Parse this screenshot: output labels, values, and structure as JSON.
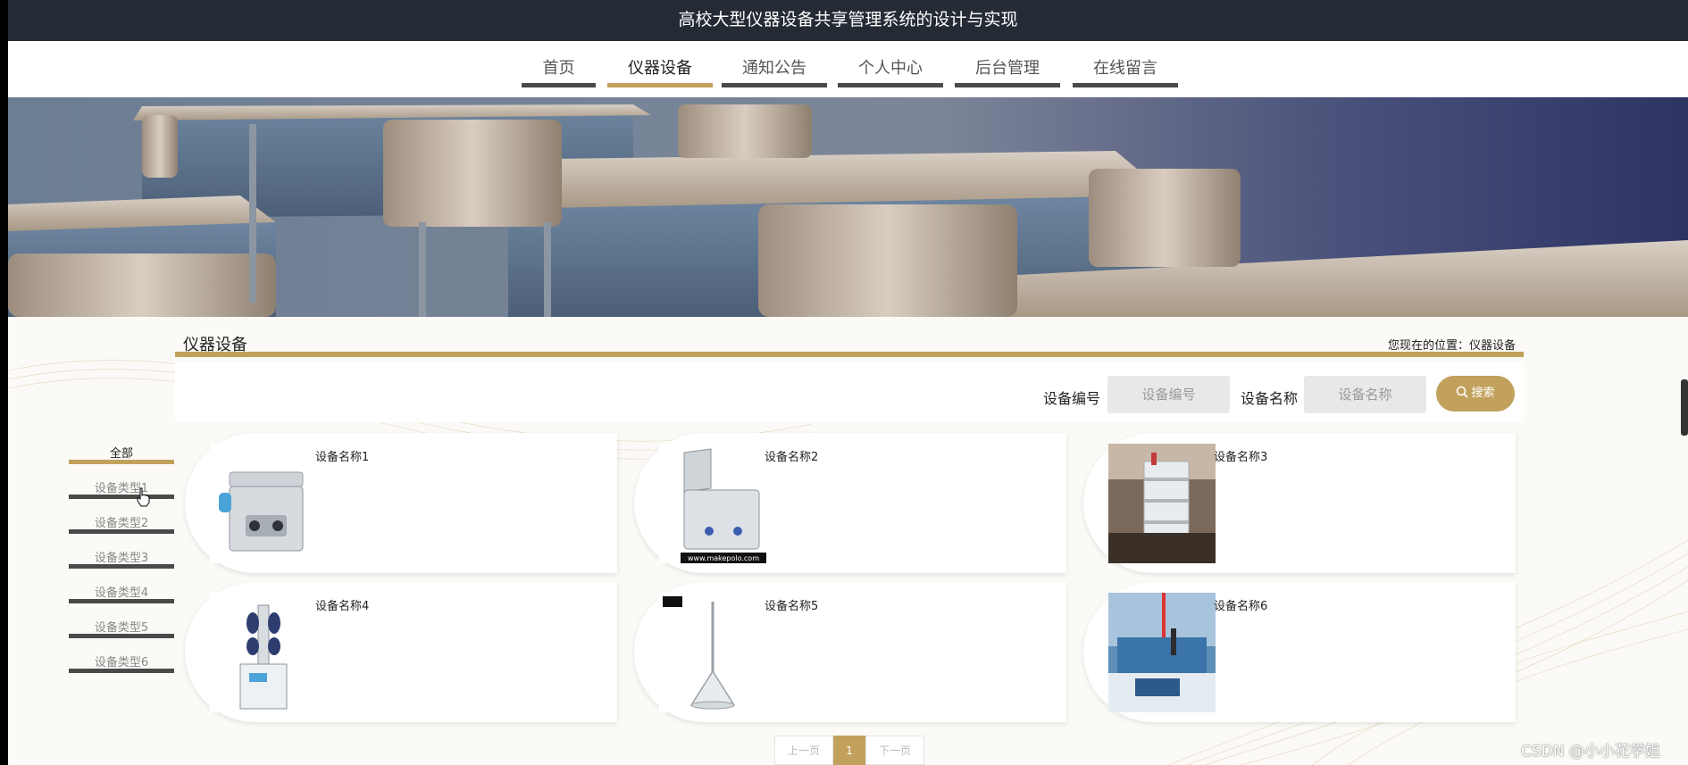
{
  "header": {
    "title": "高校大型仪器设备共享管理系统的设计与实现"
  },
  "nav": {
    "items": [
      {
        "label": "首页",
        "active": false
      },
      {
        "label": "仪器设备",
        "active": true
      },
      {
        "label": "通知公告",
        "active": false
      },
      {
        "label": "个人中心",
        "active": false
      },
      {
        "label": "后台管理",
        "active": false
      },
      {
        "label": "在线留言",
        "active": false
      }
    ]
  },
  "section": {
    "title": "仪器设备",
    "breadcrumb": "您现在的位置：仪器设备"
  },
  "search": {
    "code_label": "设备编号",
    "code_placeholder": "设备编号",
    "name_label": "设备名称",
    "name_placeholder": "设备名称",
    "button_label": "搜索",
    "button_icon": "search-icon"
  },
  "sidebar": {
    "items": [
      {
        "label": "全部",
        "active": true
      },
      {
        "label": "设备类型1",
        "active": false
      },
      {
        "label": "设备类型2",
        "active": false
      },
      {
        "label": "设备类型3",
        "active": false
      },
      {
        "label": "设备类型4",
        "active": false
      },
      {
        "label": "设备类型5",
        "active": false
      },
      {
        "label": "设备类型6",
        "active": false
      }
    ]
  },
  "cards": [
    {
      "name": "设备名称1",
      "image": "ultrasonic-cleaner-image"
    },
    {
      "name": "设备名称2",
      "image": "ultrasonic-tank-image",
      "image_caption": "www.makepolo.com"
    },
    {
      "name": "设备名称3",
      "image": "hplc-instrument-image"
    },
    {
      "name": "设备名称4",
      "image": "freeze-dryer-image"
    },
    {
      "name": "设备名称5",
      "image": "glass-funnel-image"
    },
    {
      "name": "设备名称6",
      "image": "laboratory-room-image"
    }
  ],
  "pagination": {
    "prev_label": "上一页",
    "current": "1",
    "next_label": "下一页"
  },
  "watermark": "CSDN @小小花学姐",
  "colors": {
    "accent": "#c2a15c",
    "topbar": "#252b35",
    "nav_underline": "#4a4a4a"
  }
}
